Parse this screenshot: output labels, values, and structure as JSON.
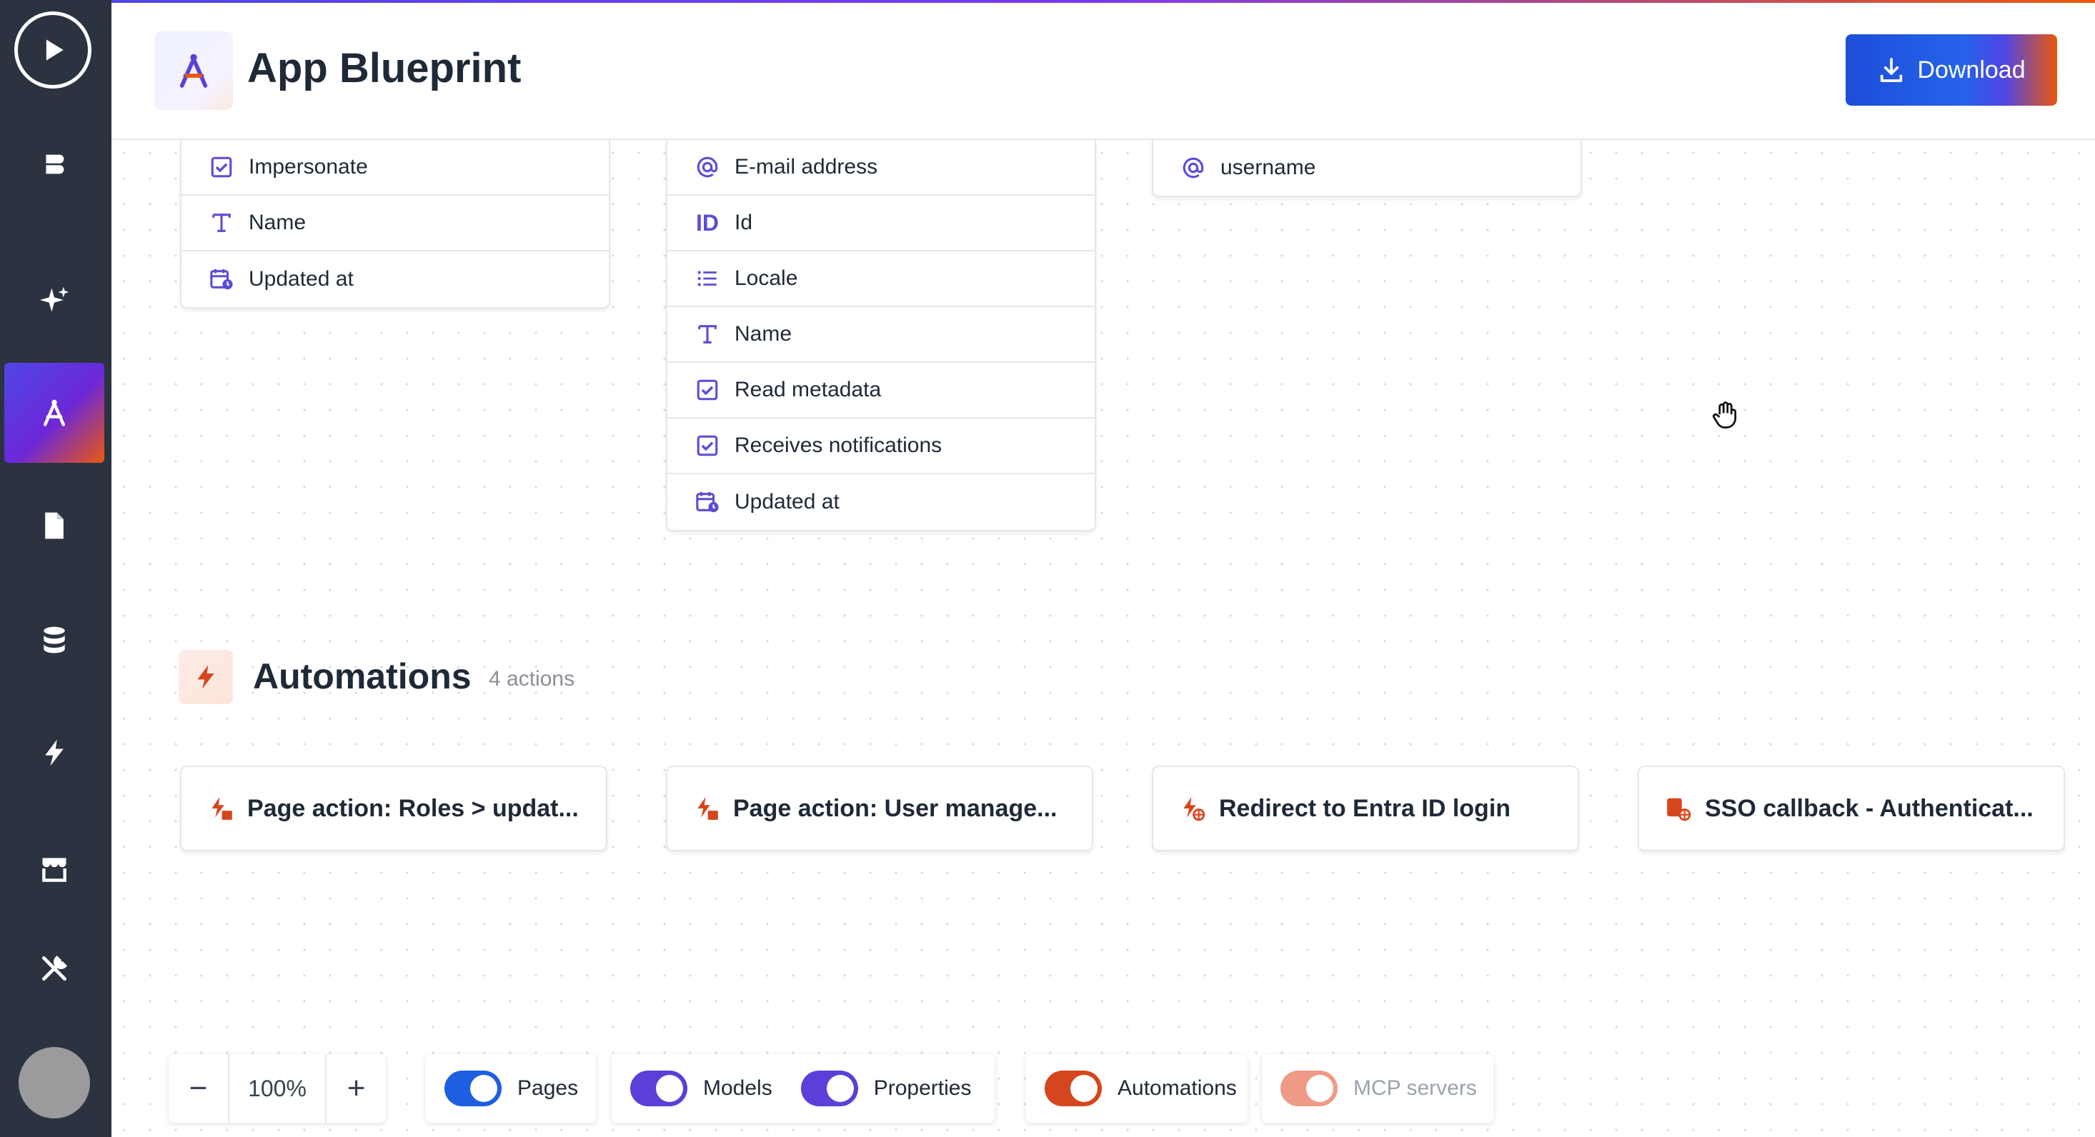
{
  "header": {
    "title": "App Blueprint",
    "download_label": "Download"
  },
  "sidebar": {
    "items": [
      {
        "icon": "layers-icon"
      },
      {
        "icon": "sparkle-icon"
      },
      {
        "icon": "blueprint-icon",
        "active": true
      },
      {
        "icon": "document-icon"
      },
      {
        "icon": "database-icon"
      },
      {
        "icon": "lightning-icon"
      },
      {
        "icon": "store-icon"
      },
      {
        "icon": "tools-icon"
      }
    ]
  },
  "models": {
    "card1": {
      "properties": [
        {
          "icon": "checkbox-icon",
          "label": "Impersonate"
        },
        {
          "icon": "text-icon",
          "label": "Name"
        },
        {
          "icon": "datetime-icon",
          "label": "Updated at"
        }
      ]
    },
    "card2": {
      "properties": [
        {
          "icon": "email-icon",
          "label": "E-mail address"
        },
        {
          "icon": "id-icon",
          "label": "Id"
        },
        {
          "icon": "list-icon",
          "label": "Locale"
        },
        {
          "icon": "text-icon",
          "label": "Name"
        },
        {
          "icon": "checkbox-icon",
          "label": "Read metadata"
        },
        {
          "icon": "checkbox-icon",
          "label": "Receives notifications"
        },
        {
          "icon": "datetime-icon",
          "label": "Updated at"
        }
      ]
    },
    "card3": {
      "properties": [
        {
          "icon": "email-icon",
          "label": "username"
        }
      ]
    }
  },
  "automations": {
    "title": "Automations",
    "count": "4 actions",
    "actions": [
      "Page action: Roles > updat...",
      "Page action: User manage...",
      "Redirect to Entra ID login",
      "SSO callback - Authenticat..."
    ]
  },
  "toolbar": {
    "zoom": "100%",
    "zoom_out": "−",
    "zoom_in": "+",
    "toggles": {
      "pages": "Pages",
      "models": "Models",
      "properties": "Properties",
      "automations": "Automations",
      "mcp": "MCP servers"
    }
  },
  "colors": {
    "sidebar_bg": "#2c3340",
    "accent_blue": "#1d5fe0",
    "accent_purple": "#5b3fd8",
    "accent_orange": "#d6461e",
    "icon_purple": "#5b4dd6"
  }
}
